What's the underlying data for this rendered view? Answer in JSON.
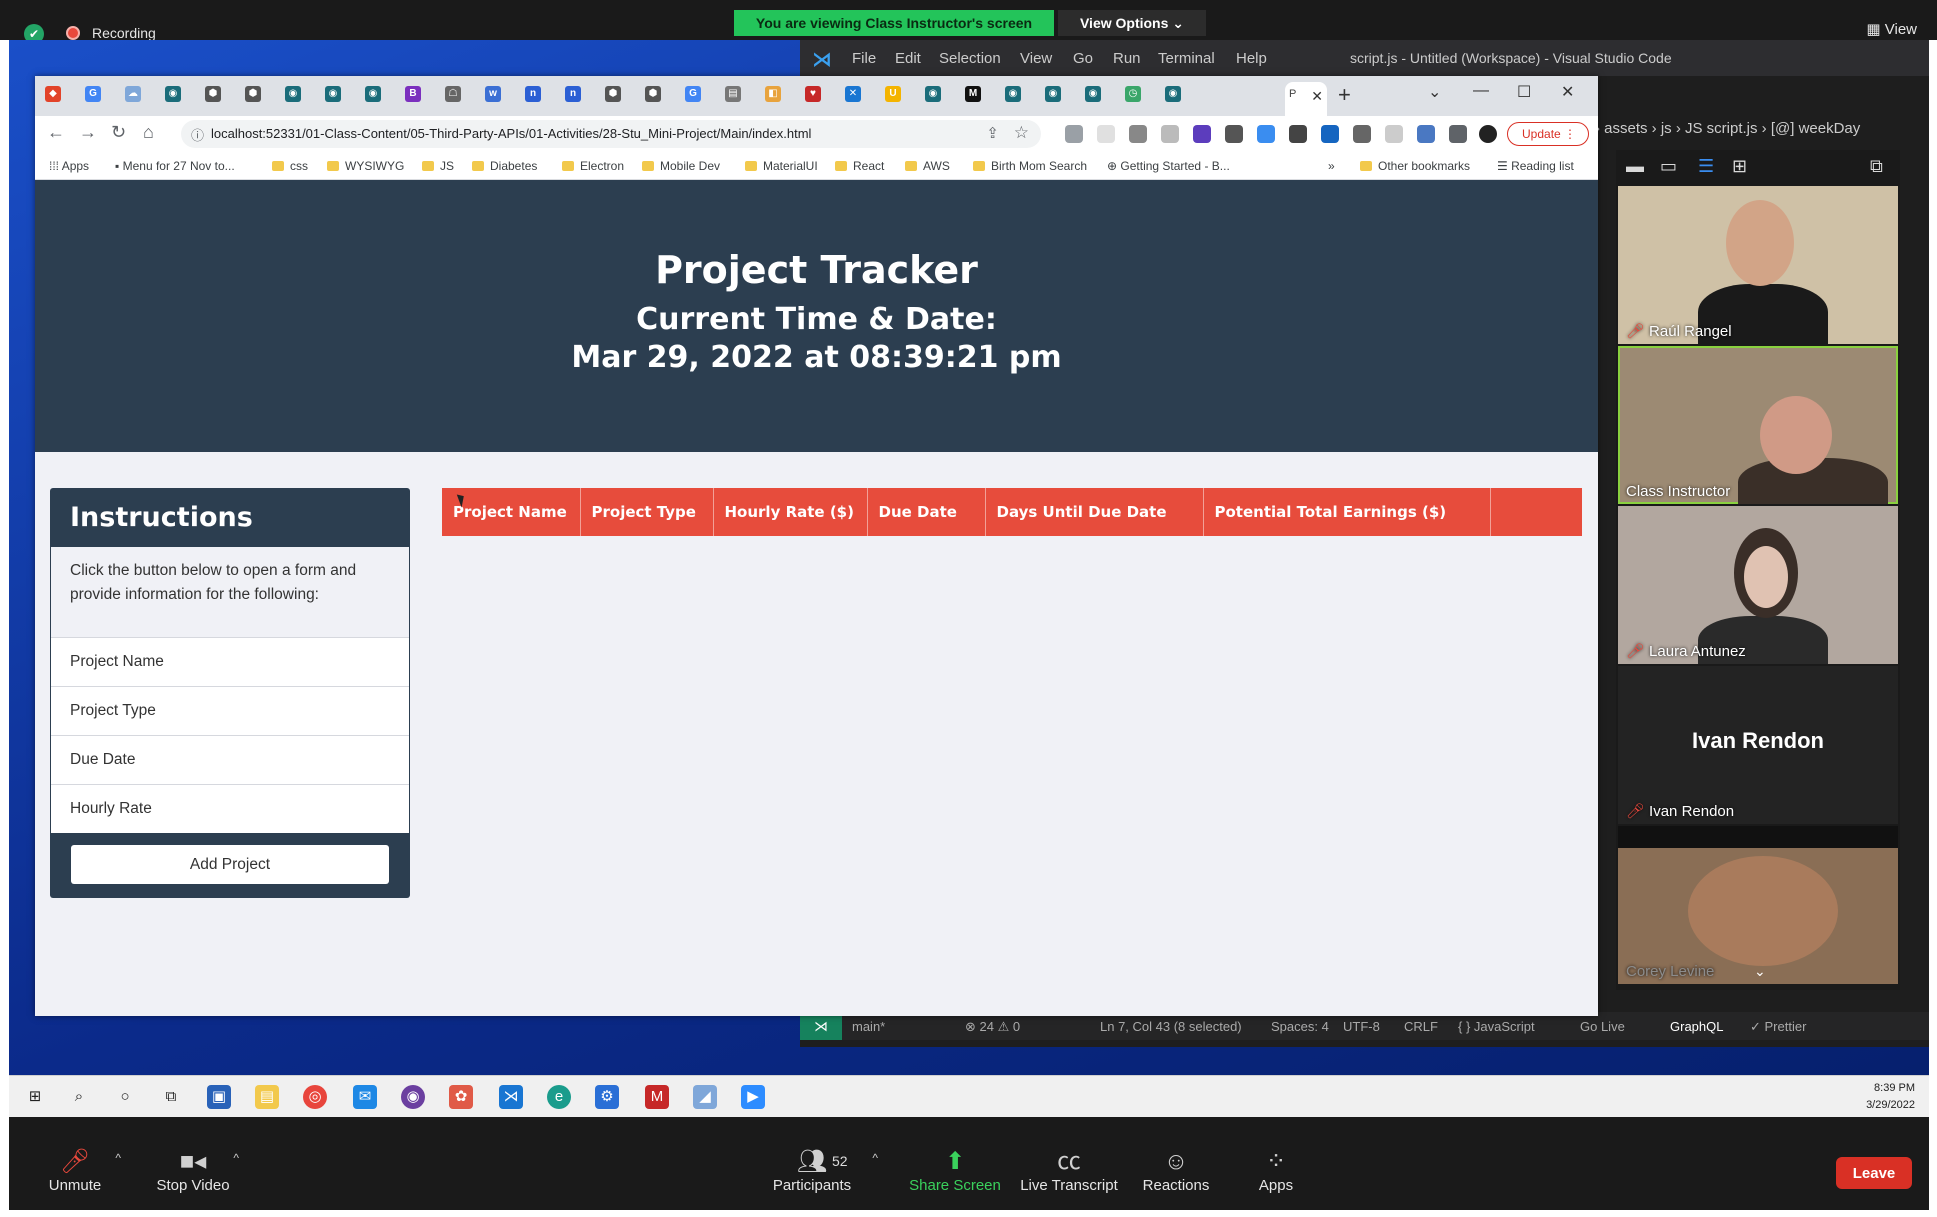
{
  "zoom": {
    "recording_label": "Recording",
    "viewing_banner": "You are viewing Class Instructor's screen",
    "view_options": "View Options ⌄",
    "view_label": "▦ View",
    "controls": {
      "unmute": "Unmute",
      "stop_video": "Stop Video",
      "participants": "Participants",
      "participants_count": "52",
      "share_screen": "Share Screen",
      "live_transcript": "Live Transcript",
      "reactions": "Reactions",
      "apps": "Apps",
      "leave": "Leave"
    },
    "tiles": [
      {
        "name": "Raúl Rangel",
        "muted": true
      },
      {
        "name": "Class Instructor",
        "muted": false
      },
      {
        "name": "Laura Antunez",
        "muted": true
      },
      {
        "name": "Ivan Rendon",
        "muted": true,
        "placeholder": "Ivan Rendon"
      },
      {
        "name": "Corey Levine",
        "muted": false
      }
    ]
  },
  "vscode": {
    "menu": [
      "File",
      "Edit",
      "Selection",
      "View",
      "Go",
      "Run",
      "Terminal",
      "Help"
    ],
    "title": "script.js - Untitled (Workspace) - Visual Studio Code",
    "breadcrumbs": "› assets › js › JS script.js › [@] weekDay",
    "status": {
      "branch": "main*",
      "problems": "⊗ 24 ⚠ 0",
      "cursor": "Ln 7, Col 43 (8 selected)",
      "spaces": "Spaces: 4",
      "encoding": "UTF-8",
      "eol": "CRLF",
      "language": "{ } JavaScript",
      "golive": "Go Live",
      "graphql": "GraphQL",
      "prettier": "✓ Prettier"
    }
  },
  "chrome": {
    "url": "localhost:52331/01-Class-Content/05-Third-Party-APIs/01-Activities/28-Stu_Mini-Project/Main/index.html",
    "active_tab_label": "P",
    "update_label": "Update",
    "bookmarks": [
      "Apps",
      "Menu for 27 Nov to...",
      "css",
      "WYSIWYG",
      "JS",
      "Diabetes",
      "Electron",
      "Mobile Dev",
      "MaterialUI",
      "React",
      "AWS",
      "Birth Mom Search",
      "Getting Started - B..."
    ],
    "other_bookmarks": "Other bookmarks",
    "reading_list": "Reading list"
  },
  "page": {
    "title": "Project Tracker",
    "subtitle": "Current Time & Date:",
    "datetime": "Mar 29, 2022 at 08:39:21 pm",
    "instructions": {
      "heading": "Instructions",
      "description": "Click the button below to open a form and provide information for the following:",
      "items": [
        "Project Name",
        "Project Type",
        "Due Date",
        "Hourly Rate"
      ],
      "button": "Add Project"
    },
    "table": {
      "headers": [
        "Project Name",
        "Project Type",
        "Hourly Rate ($)",
        "Due Date",
        "Days Until Due Date",
        "Potential Total Earnings ($)",
        ""
      ]
    }
  },
  "taskbar": {
    "time": "8:39 PM",
    "date": "3/29/2022"
  },
  "colors": {
    "hero_bg": "#2c3e50",
    "table_header_bg": "#e74c3c",
    "page_bg": "#f0f1f6",
    "zoom_leave": "#d93025",
    "share_green": "#3ad15c"
  }
}
